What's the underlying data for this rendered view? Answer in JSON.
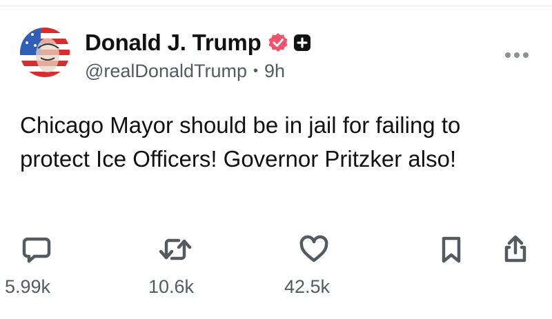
{
  "post": {
    "author_name": "Donald J. Trump",
    "handle": "@realDonaldTrump",
    "separator": "•",
    "time_ago": "9h",
    "text": "Chicago Mayor should be in jail for failing to protect Ice Officers! Governor Pritzker also!",
    "verified_color": "#f4516c"
  },
  "actions": {
    "reply_count": "5.99k",
    "repost_count": "10.6k",
    "like_count": "42.5k",
    "icons": [
      "comment-icon",
      "repost-icon",
      "heart-icon",
      "bookmark-icon",
      "share-icon"
    ]
  }
}
